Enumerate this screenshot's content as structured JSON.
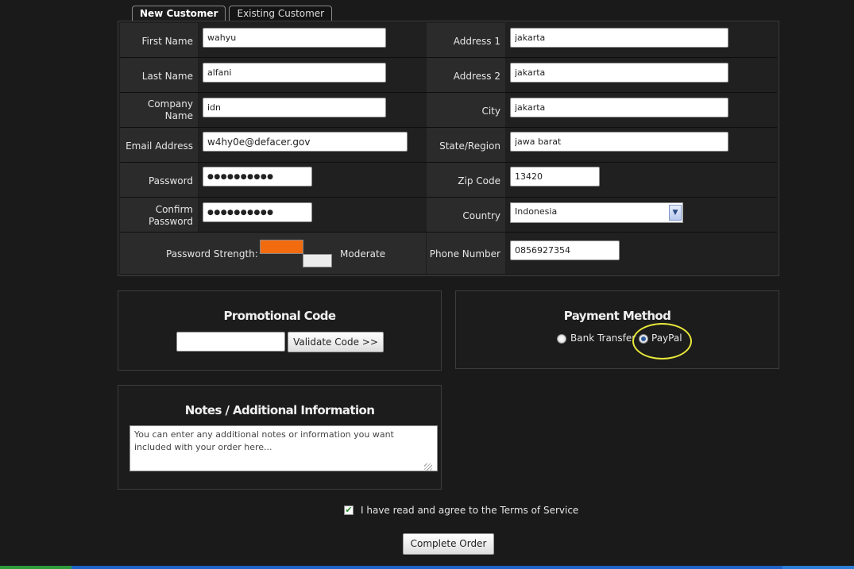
{
  "tabs": [
    {
      "label": "New Customer",
      "active": true
    },
    {
      "label": "Existing Customer",
      "active": false
    }
  ],
  "form": {
    "first_name": {
      "label": "First Name",
      "value": "wahyu"
    },
    "last_name": {
      "label": "Last Name",
      "value": "alfani"
    },
    "company_name": {
      "label_line1": "Company",
      "label_line2": "Name",
      "value": "idn"
    },
    "email": {
      "label": "Email Address",
      "value": "w4hy0e@defacer.gov"
    },
    "password": {
      "label": "Password",
      "value": "●●●●●●●●●●"
    },
    "confirm_password": {
      "label_line1": "Confirm",
      "label_line2": "Password",
      "value": "●●●●●●●●●●"
    },
    "password_strength": {
      "label": "Password Strength:",
      "level": "Moderate",
      "color_fill": "#f26b0f"
    },
    "address1": {
      "label": "Address 1",
      "value": "jakarta"
    },
    "address2": {
      "label": "Address 2",
      "value": "jakarta"
    },
    "city": {
      "label": "City",
      "value": "jakarta"
    },
    "state": {
      "label": "State/Region",
      "value": "jawa barat"
    },
    "zip": {
      "label": "Zip Code",
      "value": "13420"
    },
    "country": {
      "label": "Country",
      "value": "Indonesia",
      "icon": "chevron-down-icon"
    },
    "phone": {
      "label": "Phone Number",
      "value": "0856927354"
    }
  },
  "promo": {
    "title": "Promotional Code",
    "input_value": "",
    "button_label": "Validate Code >>"
  },
  "payment": {
    "title": "Payment Method",
    "options": [
      {
        "label": "Bank Transfer",
        "checked": false
      },
      {
        "label": "PayPal",
        "checked": true
      }
    ],
    "highlight_color": "#e8e83a"
  },
  "notes": {
    "title": "Notes / Additional Information",
    "text": "You can enter any additional notes or information you want included with your order here..."
  },
  "terms": {
    "label": "I have read and agree to the Terms of Service",
    "checked": true,
    "check_glyph": "✔"
  },
  "complete_button": "Complete Order"
}
